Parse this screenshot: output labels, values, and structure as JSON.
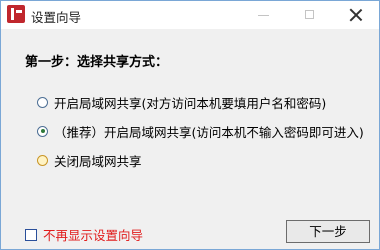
{
  "window": {
    "title": "设置向导",
    "icons": {
      "app": "app-logo-icon",
      "minimize": "minimize-icon",
      "maximize": "maximize-icon",
      "close": "close-icon"
    }
  },
  "step": {
    "heading": "第一步：选择共享方式："
  },
  "options": [
    {
      "label": "开启局域网共享(对方访问本机要填用户名和密码)",
      "selected": false
    },
    {
      "label": "（推荐）开启局域网共享(访问本机不输入密码即可进入)",
      "selected": true
    },
    {
      "label": "关闭局域网共享",
      "selected": false
    }
  ],
  "dont_show_again": {
    "label": "不再显示设置向导",
    "checked": false,
    "color": "#e11b1b"
  },
  "buttons": {
    "next_label": "下一步"
  }
}
